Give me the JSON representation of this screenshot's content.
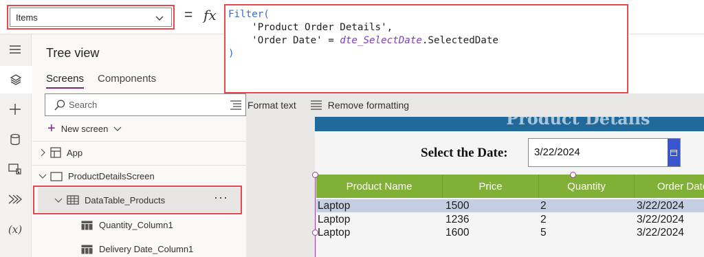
{
  "property_dropdown": {
    "value": "Items"
  },
  "formula_bar": {
    "equals": "=",
    "fx": "fx",
    "lines": {
      "l1_fn": "Filter(",
      "l2": "'Product Order Details',",
      "l3_a": "'Order Date' = ",
      "l3_ctl": "dte_SelectDate",
      "l3_b": ".SelectedDate",
      "l4": ")"
    }
  },
  "tree_view": {
    "title": "Tree view",
    "tabs": [
      "Screens",
      "Components"
    ],
    "search_placeholder": "Search",
    "new_screen": "New screen",
    "nodes": {
      "app": "App",
      "screen": "ProductDetailsScreen",
      "table": "DataTable_Products",
      "table_more": "···",
      "columns": [
        "Quantity_Column1",
        "Delivery Date_Column1"
      ]
    }
  },
  "format_toolbar": {
    "format_text": "Format text",
    "remove_formatting": "Remove formatting"
  },
  "app_screen": {
    "header_title": "Product Details",
    "select_label": "Select the Date:",
    "date_value": "3/22/2024",
    "table": {
      "headers": [
        "Product Name",
        "Price",
        "Quantity",
        "Order Date"
      ],
      "rows": [
        [
          "Laptop",
          "1500",
          "2",
          "3/22/2024"
        ],
        [
          "Laptop",
          "1236",
          "2",
          "3/22/2024"
        ],
        [
          "Laptop",
          "1600",
          "5",
          "3/22/2024"
        ]
      ]
    }
  },
  "colors": {
    "highlight": "#e8474c",
    "accent": "#742774",
    "table_header": "#80b035",
    "header_bar": "#1f6a9b",
    "calendar_button": "#3b55ce"
  },
  "icons": [
    "chevron-down-icon",
    "hamburger-icon",
    "layers-icon",
    "plus-icon",
    "database-icon",
    "media-icon",
    "power-automate-icon",
    "variable-icon",
    "search-icon",
    "screen-icon",
    "table-icon",
    "column-icon",
    "format-text-icon",
    "remove-formatting-icon",
    "calendar-icon"
  ]
}
